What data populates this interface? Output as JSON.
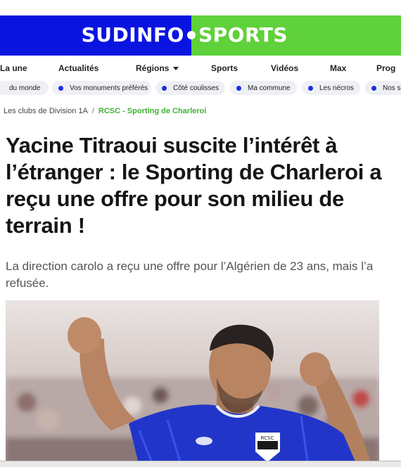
{
  "site": {
    "logo_left": "SUDINFO",
    "logo_right": "SPORTS",
    "brand_blue": "#0a14e0",
    "brand_green": "#5fd13a"
  },
  "nav": {
    "items": [
      "La une",
      "Actualités",
      "Régions",
      "Sports",
      "Vidéos",
      "Max",
      "Prog"
    ]
  },
  "chips": {
    "items": [
      "du monde",
      "Vos monuments préférés",
      "Côté coulisses",
      "Ma commune",
      "Les nécros",
      "Nos s"
    ]
  },
  "breadcrumb": {
    "items": [
      "Les clubs de Division 1A",
      "RCSC - Sporting de Charleroi"
    ],
    "separator": "/"
  },
  "article": {
    "title": "Yacine Titraoui suscite l’intérêt à l’étranger : le Sporting de Charleroi a reçu une offre pour son milieu de terrain !",
    "lede": "La direction carolo a reçu une offre pour l’Algérien de 23 ans, mais l’a refusée.",
    "image_alt": "Yacine Titraoui celebrating",
    "jersey_badge": "RCSC"
  }
}
